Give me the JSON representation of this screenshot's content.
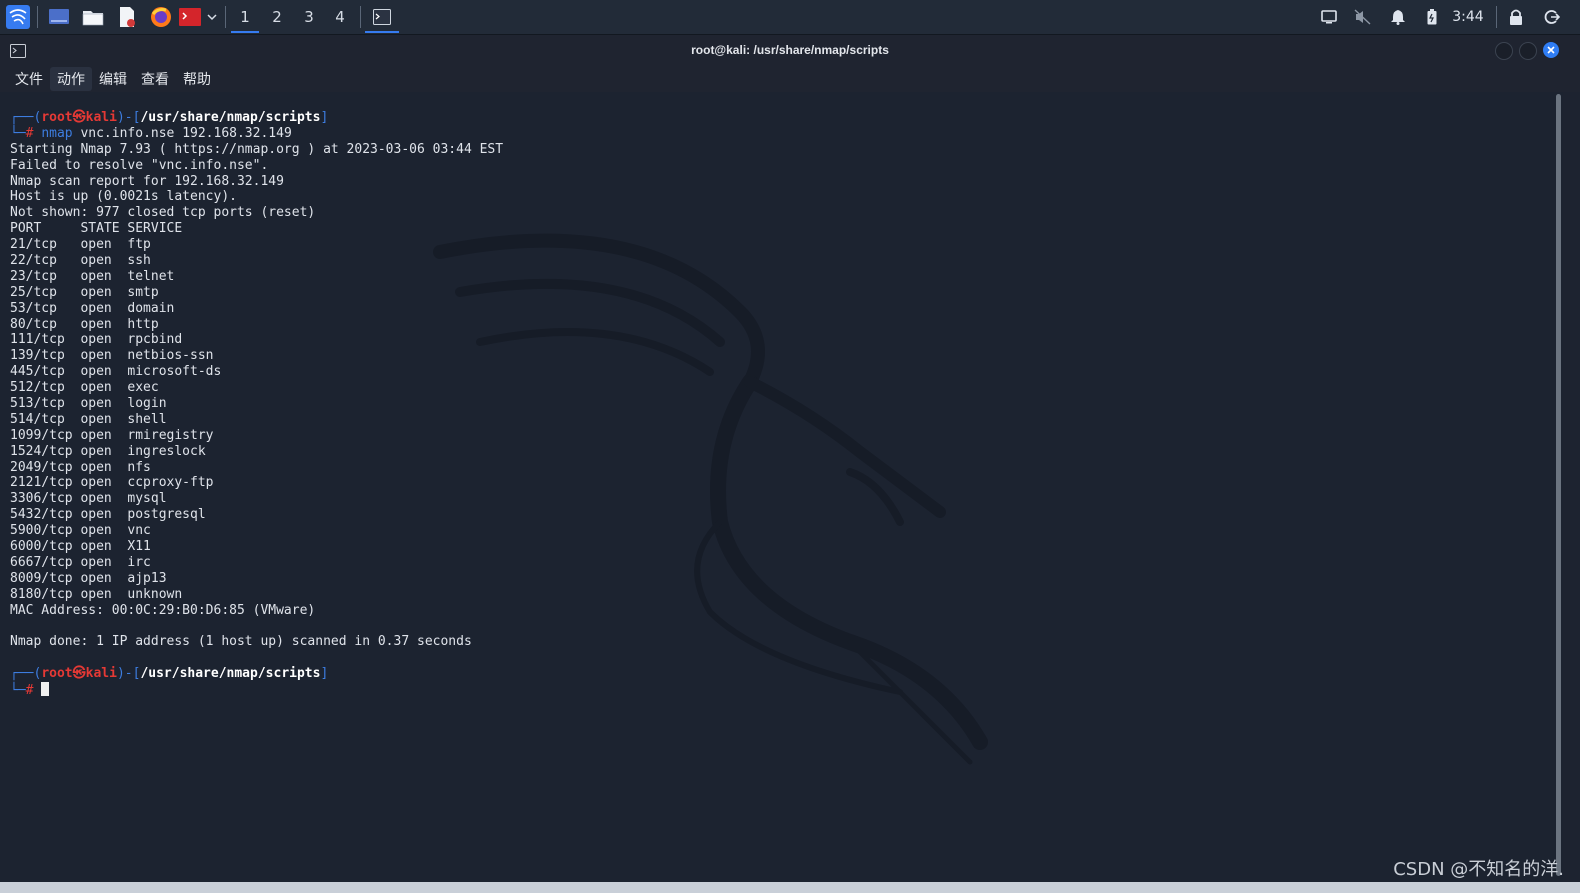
{
  "taskbar": {
    "workspaces": [
      "1",
      "2",
      "3",
      "4"
    ],
    "active_workspace": "1",
    "clock": "3:44",
    "icons": [
      "kali-menu-icon",
      "desktop-icon",
      "file-manager-icon",
      "text-editor-icon",
      "firefox-icon",
      "terminal-launcher-icon",
      "dropdown-icon",
      "terminal-task-icon",
      "display-icon",
      "mute-icon",
      "bell-icon",
      "battery-icon",
      "lock-icon",
      "logout-icon"
    ]
  },
  "window": {
    "title": "root@kali: /usr/share/nmap/scripts"
  },
  "menu": {
    "file": "文件",
    "action": "动作",
    "edit": "编辑",
    "view": "查看",
    "help": "帮助"
  },
  "prompt": {
    "open": "┌──(",
    "user": "root",
    "at": "㉿",
    "host": "kali",
    "close": ")-[",
    "path": "/usr/share/nmap/scripts",
    "end": "]",
    "corner": "└─",
    "hash": "#"
  },
  "command": {
    "name": "nmap",
    "args": " vnc.info.nse 192.168.32.149"
  },
  "output": [
    "Starting Nmap 7.93 ( https://nmap.org ) at 2023-03-06 03:44 EST",
    "Failed to resolve \"vnc.info.nse\".",
    "Nmap scan report for 192.168.32.149",
    "Host is up (0.0021s latency).",
    "Not shown: 977 closed tcp ports (reset)",
    "PORT     STATE SERVICE",
    "21/tcp   open  ftp",
    "22/tcp   open  ssh",
    "23/tcp   open  telnet",
    "25/tcp   open  smtp",
    "53/tcp   open  domain",
    "80/tcp   open  http",
    "111/tcp  open  rpcbind",
    "139/tcp  open  netbios-ssn",
    "445/tcp  open  microsoft-ds",
    "512/tcp  open  exec",
    "513/tcp  open  login",
    "514/tcp  open  shell",
    "1099/tcp open  rmiregistry",
    "1524/tcp open  ingreslock",
    "2049/tcp open  nfs",
    "2121/tcp open  ccproxy-ftp",
    "3306/tcp open  mysql",
    "5432/tcp open  postgresql",
    "5900/tcp open  vnc",
    "6000/tcp open  X11",
    "6667/tcp open  irc",
    "8009/tcp open  ajp13",
    "8180/tcp open  unknown",
    "MAC Address: 00:0C:29:B0:D6:85 (VMware)",
    "",
    "Nmap done: 1 IP address (1 host up) scanned in 0.37 seconds",
    ""
  ],
  "watermark": "CSDN @不知名的洋.",
  "colors": {
    "terminal_bg": "#1c2330",
    "prompt_blue": "#3d7de0",
    "prompt_red": "#e53935",
    "accent": "#367bf0"
  }
}
